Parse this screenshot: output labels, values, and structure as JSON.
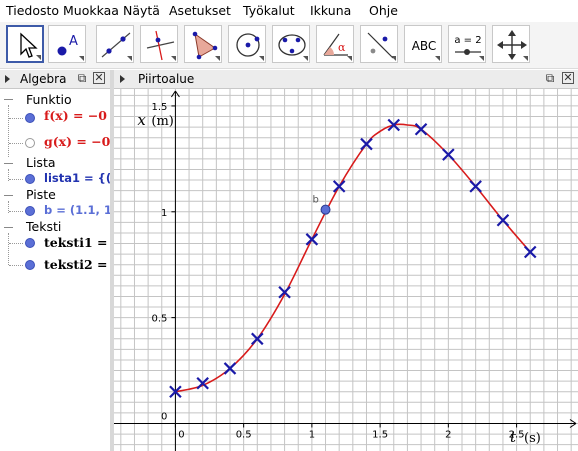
{
  "menu": [
    "Tiedosto",
    "Muokkaa",
    "Näytä",
    "Asetukset",
    "Työkalut",
    "Ikkuna",
    "Ohje"
  ],
  "toolbar": {
    "tools": [
      {
        "name": "move-tool-icon"
      },
      {
        "name": "point-tool-icon",
        "glyph": "A"
      },
      {
        "name": "line-tool-icon"
      },
      {
        "name": "perpendicular-line-tool-icon"
      },
      {
        "name": "polygon-tool-icon"
      },
      {
        "name": "circle-tool-icon"
      },
      {
        "name": "conic-tool-icon"
      },
      {
        "name": "angle-tool-icon",
        "glyph": "α"
      },
      {
        "name": "reflect-tool-icon"
      },
      {
        "name": "text-tool-icon",
        "glyph": "ABC"
      },
      {
        "name": "slider-tool-icon",
        "glyph": "a = 2"
      },
      {
        "name": "move-view-tool-icon"
      }
    ]
  },
  "algebra": {
    "title": "Algebra",
    "groups": {
      "function": "Funktio",
      "list": "Lista",
      "point": "Piste",
      "text": "Teksti"
    },
    "entries": {
      "f": "f(x) = −0",
      "g": "g(x) = −0",
      "lista1": "lista1 = {(0,",
      "b": "b = (1.1, 1.0",
      "teksti1": "teksti1 =",
      "teksti2": "teksti2 ="
    },
    "colors": {
      "f": "#d81b1b",
      "g": "#d81b1b",
      "lista1": "#2233b0",
      "b": "#5b6fd6",
      "teksti": "#000000"
    }
  },
  "graphics": {
    "title": "Piirtoalue",
    "x_axis_label": "t",
    "x_axis_unit": "(s)",
    "y_axis_label": "x",
    "y_axis_unit": "(m)",
    "point_label": "b"
  },
  "chart_data": {
    "type": "scatter",
    "x_ticks": [
      "0",
      "0.5",
      "1",
      "1.5",
      "2",
      "2.5"
    ],
    "y_ticks": [
      "0",
      "0.5",
      "1",
      "1.5"
    ],
    "xlim": [
      -0.45,
      2.95
    ],
    "ylim": [
      -0.13,
      1.58
    ],
    "grid": true,
    "series": [
      {
        "style": "cross markers",
        "color": "#1a1aa8",
        "x": [
          0,
          0.2,
          0.4,
          0.6,
          0.8,
          1.0,
          1.2,
          1.4,
          1.6,
          1.8,
          2.0,
          2.2,
          2.4,
          2.6
        ],
        "y": [
          0.15,
          0.19,
          0.26,
          0.4,
          0.62,
          0.87,
          1.12,
          1.32,
          1.41,
          1.39,
          1.27,
          1.12,
          0.96,
          0.81
        ]
      },
      {
        "style": "curve",
        "color": "#d81b1b",
        "x": [
          0,
          0.2,
          0.4,
          0.6,
          0.8,
          1.0,
          1.2,
          1.4,
          1.5,
          1.6,
          1.7,
          1.8,
          2.0,
          2.2,
          2.4,
          2.6
        ],
        "y": [
          0.15,
          0.18,
          0.26,
          0.4,
          0.61,
          0.87,
          1.12,
          1.32,
          1.38,
          1.41,
          1.41,
          1.39,
          1.27,
          1.12,
          0.96,
          0.81
        ]
      },
      {
        "style": "point",
        "color": "#5b6fd6",
        "x": [
          1.1
        ],
        "y": [
          1.01
        ]
      }
    ]
  }
}
